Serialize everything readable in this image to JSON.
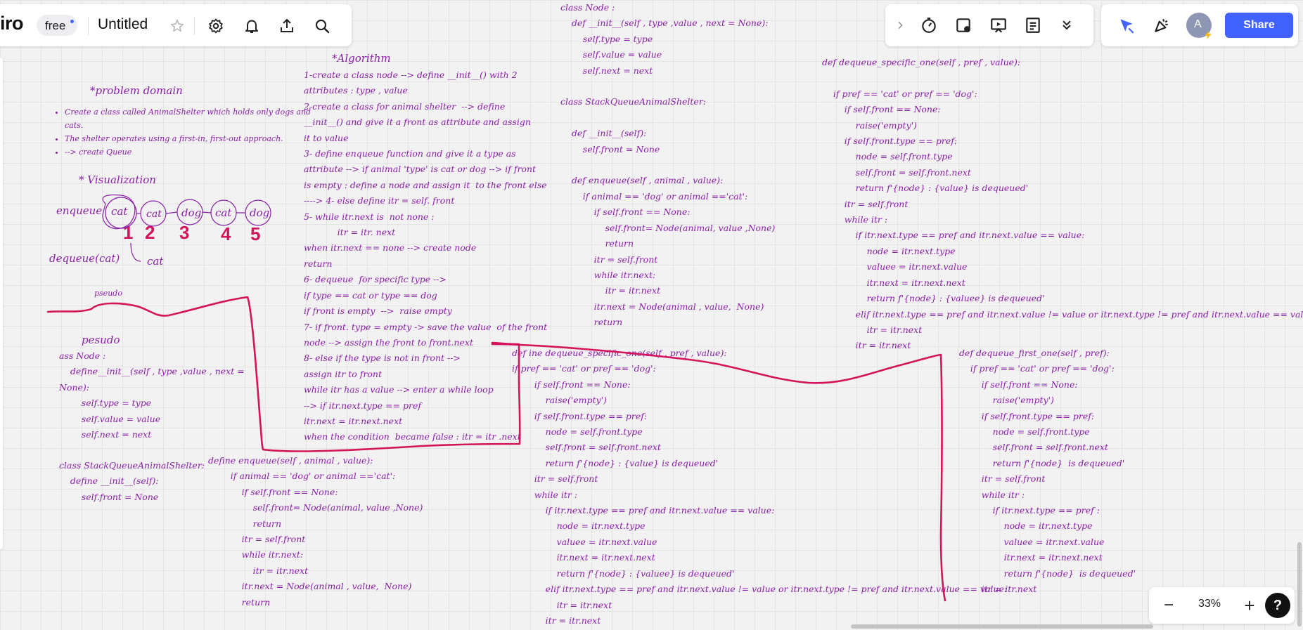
{
  "topbar": {
    "logo": "iro",
    "plan_badge": "free",
    "board_title": "Untitled"
  },
  "share_label": "Share",
  "avatar_initial": "A",
  "zoom": {
    "level": "33%",
    "minus": "−",
    "plus": "+",
    "help": "?"
  },
  "board": {
    "problem_title": "*problem domain",
    "problem_items": [
      "Create a class called AnimalShelter which holds only dogs and\ncats.",
      "The shelter operates using a first-in, first-out approach.",
      "--> create Queue"
    ],
    "visualization_title": "* Visualization",
    "enqueue_label": "enqueue",
    "dequeue_label": "dequeue(cat)",
    "dequeue_result": "cat",
    "nodes": [
      "cat",
      "cat",
      "dog",
      "cat",
      "dog"
    ],
    "node_numbers": [
      "1",
      "2",
      "3",
      "4",
      "5"
    ],
    "pseudo_small": "pseudo",
    "pseudo_title": "pesudo",
    "pseudo_node_code": "ass Node :\n    define__init__(self , type ,value , next =\nNone):\n        self.type = type\n        self.value = value\n        self.next = next",
    "pseudo_shelter_code": "class StackQueueAnimalShelter:\n    define __init__(self):\n        self.front = None",
    "algorithm_title": "*Algorithm",
    "algorithm_text": "1-create a class node --> define __init__() with 2\nattributes : type , value\n2-create a class for animal shelter  --> define\n__init__() and give it a front as attribute and assign\nit to value\n3- define enqueue function and give it a type as\nattribute --> if animal 'type' is cat or dog --> if front\nis empty : define a node and assign it  to the front else\n----> 4- else define itr = self. front\n5- while itr.next is  not none :\n            itr = itr. next\nwhen itr.next == none --> create node\nreturn\n6- dequeue  for specific type -->\nif type == cat or type == dog\nif front is empty  -->  raise empty\n7- if front. type = empty -> save the value  of the front\nnode --> assign the front to front.next\n8- else if the type is not in front -->\nassign itr to front\nwhile itr has a value --> enter a while loop\n--> if itr.next.type == pref\nitr.next = itr.next.next\nwhen the condition  became false : itr = itr .next",
    "enqueue_code": "define enqueue(self , animal , value):\n        if animal == 'dog' or animal =='cat':\n            if self.front == None:\n                self.front= Node(animal, value ,None)\n                return\n            itr = self.front\n            while itr.next:\n                itr = itr.next\n            itr.next = Node(animal , value,  None)\n            return",
    "class_code": "class Node :\n    def __init__(self , type ,value , next = None):\n        self.type = type\n        self.value = value\n        self.next = next\n\nclass StackQueueAnimalShelter:\n\n    def __init__(self):\n        self.front = None\n\n    def enqueue(self , animal , value):\n        if animal == 'dog' or animal =='cat':\n            if self.front == None:\n                self.front= Node(animal, value ,None)\n                return\n            itr = self.front\n            while itr.next:\n                itr = itr.next\n            itr.next = Node(animal , value,  None)\n            return",
    "specific_code_1": "def ine dequeue_specific_one(self , pref , value):\nif pref == 'cat' or pref == 'dog':\n        if self.front == None:\n            raise('empty')\n        if self.front.type == pref:\n            node = self.front.type\n            self.front = self.front.next\n            return f'{node} : {value} is dequeued'\n        itr = self.front\n        while itr :\n            if itr.next.type == pref and itr.next.value == value:\n                node = itr.next.type\n                valuee = itr.next.value\n                itr.next = itr.next.next\n                return f'{node} : {valuee} is dequeued'\n            elif itr.next.type == pref and itr.next.value != value or itr.next.type != pref and itr.next.value == value:\n                itr = itr.next\n            itr = itr.next",
    "specific_code_2": "def dequeue_specific_one(self , pref , value):\n\n    if pref == 'cat' or pref == 'dog':\n        if self.front == None:\n            raise('empty')\n        if self.front.type == pref:\n            node = self.front.type\n            self.front = self.front.next\n            return f'{node} : {value} is dequeued'\n        itr = self.front\n        while itr :\n            if itr.next.type == pref and itr.next.value == value:\n                node = itr.next.type\n                valuee = itr.next.value\n                itr.next = itr.next.next\n                return f'{node} : {valuee} is dequeued'\n            elif itr.next.type == pref and itr.next.value != value or itr.next.type != pref and itr.next.value == value:\n                itr = itr.next\n            itr = itr.next",
    "first_code": "def dequeue_first_one(self , pref):\n    if pref == 'cat' or pref == 'dog':\n        if self.front == None:\n            raise('empty')\n        if self.front.type == pref:\n            node = self.front.type\n            self.front = self.front.next\n            return f'{node}  is dequeued'\n        itr = self.front\n        while itr :\n            if itr.next.type == pref :\n                node = itr.next.type\n                valuee = itr.next.value\n                itr.next = itr.next.next\n                return f'{node}  is dequeued'\n        itr = itr.next"
  },
  "colors": {
    "ink": "#8a1fa8",
    "pen": "#d4145a",
    "accent": "#4262ff",
    "avatar": "#8d96b3"
  }
}
